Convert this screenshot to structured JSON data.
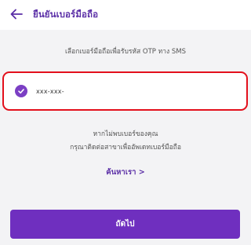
{
  "header": {
    "title": "ยืนยันเบอร์มือถือ",
    "back_icon": "arrow-left-icon"
  },
  "instruction": "เลือกเบอร์มือถือเพื่อรับรหัส OTP ทาง SMS",
  "phone_option": {
    "number": "xxx-xxx-",
    "selected": true,
    "check_icon": "check-circle-icon"
  },
  "help": {
    "line1": "หากไม่พบเบอร์ของคุณ",
    "line2": "กรุณาติดต่อสาขาเพื่ออัพเดทเบอร์มือถือ",
    "link": "ค้นหาเรา >"
  },
  "next_button": "ถัดไป",
  "colors": {
    "accent": "#6f2fbf",
    "title": "#5a2ea6",
    "highlight_border": "#e3101c",
    "background": "#f3f3f5"
  }
}
